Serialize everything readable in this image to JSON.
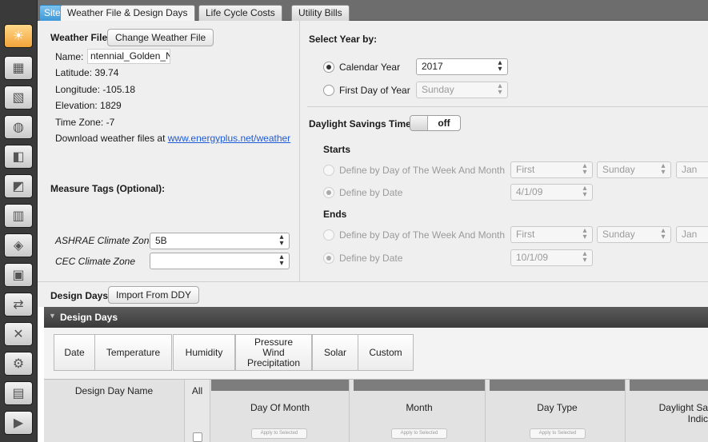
{
  "sidebar": {
    "items": [
      {
        "icon": "sun-icon",
        "glyph": "☀",
        "active": true
      },
      {
        "icon": "calendar-icon",
        "glyph": "▦"
      },
      {
        "icon": "constructions-icon",
        "glyph": "▧"
      },
      {
        "icon": "loads-icon",
        "glyph": "◍"
      },
      {
        "icon": "space-types-icon",
        "glyph": "◧"
      },
      {
        "icon": "geometry-icon",
        "glyph": "◩"
      },
      {
        "icon": "facility-icon",
        "glyph": "▥"
      },
      {
        "icon": "spaces-icon",
        "glyph": "◈"
      },
      {
        "icon": "thermal-zones-icon",
        "glyph": "▣"
      },
      {
        "icon": "hvac-icon",
        "glyph": "⇄"
      },
      {
        "icon": "measures-icon",
        "glyph": "✕"
      },
      {
        "icon": "simulation-settings-icon",
        "glyph": "⚙"
      },
      {
        "icon": "scripts-icon",
        "glyph": "▤"
      },
      {
        "icon": "run-icon",
        "glyph": "▶"
      }
    ]
  },
  "tabs": {
    "site": "Site",
    "weather": "Weather File & Design Days",
    "lcc": "Life Cycle Costs",
    "utility": "Utility Bills"
  },
  "weather": {
    "heading": "Weather File",
    "change_button": "Change Weather File",
    "name_label": "Name:",
    "name_value": "ntennial_Golden_Nr",
    "latitude": "Latitude: 39.74",
    "longitude": "Longitude: -105.18",
    "elevation": "Elevation: 1829",
    "timezone": "Time Zone: -7",
    "download_text": "Download weather files at ",
    "download_link": "www.energyplus.net/weather"
  },
  "measure_tags": {
    "heading": "Measure Tags (Optional):",
    "ashrae_label": "ASHRAE Climate Zone",
    "ashrae_value": "5B",
    "cec_label": "CEC Climate Zone",
    "cec_value": ""
  },
  "year": {
    "heading": "Select Year by:",
    "calendar_label": "Calendar Year",
    "calendar_value": "2017",
    "firstday_label": "First Day of Year",
    "firstday_value": "Sunday"
  },
  "dst": {
    "label": "Daylight Savings Time:",
    "toggle_state": "off",
    "starts": "Starts",
    "ends": "Ends",
    "by_week_label": "Define by Day of The Week And Month",
    "by_date_label": "Define by Date",
    "start_week": "First",
    "start_day": "Sunday",
    "start_month": "Jan",
    "start_date": "4/1/09",
    "end_week": "First",
    "end_day": "Sunday",
    "end_month": "Jan",
    "end_date": "10/1/09"
  },
  "design_days": {
    "label": "Design Days",
    "import_button": "Import From DDY",
    "header": "Design Days",
    "field_tabs": [
      "Date",
      "Temperature",
      "Humidity",
      "Pressure Wind Precipitation",
      "Solar",
      "Custom"
    ],
    "pressure_lines": [
      "Pressure",
      "Wind",
      "Precipitation"
    ],
    "columns": {
      "name": "Design Day Name",
      "all": "All",
      "day_of_month": "Day Of Month",
      "month": "Month",
      "day_type": "Day Type",
      "dst_line1": "Daylight Sa",
      "dst_line2": "Indic"
    },
    "apply_label": "Apply to Selected"
  }
}
